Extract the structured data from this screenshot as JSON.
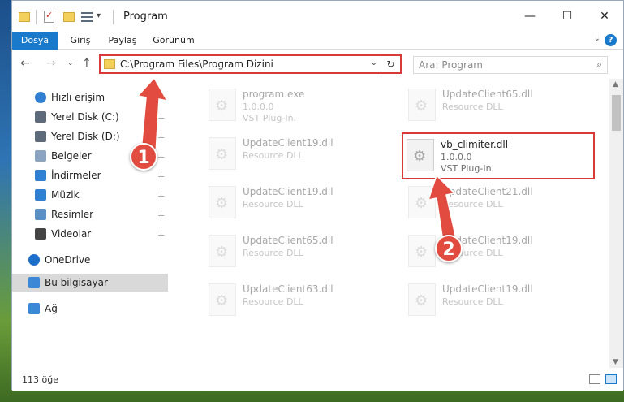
{
  "window": {
    "title": "Program",
    "minimize_glyph": "—",
    "maximize_glyph": "☐",
    "close_glyph": "✕"
  },
  "quick_access_toolbar": {
    "dropdown_glyph": "▾"
  },
  "ribbon": {
    "tabs": [
      "Dosya",
      "Giriş",
      "Paylaş",
      "Görünüm"
    ],
    "expand_glyph": "⌄",
    "help_glyph": "?"
  },
  "navigation": {
    "back_glyph": "←",
    "forward_glyph": "→",
    "recent_glyph": "⌄",
    "up_glyph": "↑"
  },
  "address_bar": {
    "path": "C:\\Program Files\\Program Dizini",
    "dropdown_glyph": "⌄",
    "refresh_glyph": "↻"
  },
  "search": {
    "placeholder": "Ara: Program",
    "icon": "search-icon"
  },
  "sidebar": {
    "items": [
      {
        "label": "Hızlı erişim",
        "icon": "star-icon",
        "pinned": false
      },
      {
        "label": "Yerel Disk (C:)",
        "icon": "drive-icon",
        "pinned": true
      },
      {
        "label": "Yerel Disk (D:)",
        "icon": "drive-icon",
        "pinned": true
      },
      {
        "label": "Belgeler",
        "icon": "documents-icon",
        "pinned": true
      },
      {
        "label": "İndirmeler",
        "icon": "download-icon",
        "pinned": true
      },
      {
        "label": "Müzik",
        "icon": "music-icon",
        "pinned": true
      },
      {
        "label": "Resimler",
        "icon": "pictures-icon",
        "pinned": true
      },
      {
        "label": "Videolar",
        "icon": "videos-icon",
        "pinned": true
      },
      {
        "label": "OneDrive",
        "icon": "cloud-icon",
        "pinned": false
      },
      {
        "label": "Bu bilgisayar",
        "icon": "computer-icon",
        "pinned": false,
        "selected": true
      },
      {
        "label": "Ağ",
        "icon": "network-icon",
        "pinned": false
      }
    ],
    "pin_glyph": "📌"
  },
  "files": [
    {
      "name": "program.exe",
      "line1": "1.0.0.0",
      "line2": "VST Plug-In.",
      "faded": true
    },
    {
      "name": "UpdateClient65.dll",
      "line1": "Resource DLL",
      "line2": "",
      "faded": true
    },
    {
      "name": "UpdateClient19.dll",
      "line1": "Resource DLL",
      "line2": "",
      "faded": true
    },
    {
      "name": "vb_climiter.dll",
      "line1": "1.0.0.0",
      "line2": "VST Plug-In.",
      "faded": false,
      "highlighted": true
    },
    {
      "name": "UpdateClient19.dll",
      "line1": "Resource DLL",
      "line2": "",
      "faded": true
    },
    {
      "name": "UpdateClient21.dll",
      "line1": "Resource DLL",
      "line2": "",
      "faded": true
    },
    {
      "name": "UpdateClient65.dll",
      "line1": "Resource DLL",
      "line2": "",
      "faded": true
    },
    {
      "name": "UpdateClient19.dll",
      "line1": "Resource DLL",
      "line2": "",
      "faded": true
    },
    {
      "name": "UpdateClient63.dll",
      "line1": "Resource DLL",
      "line2": "",
      "faded": true
    },
    {
      "name": "UpdateClient19.dll",
      "line1": "Resource DLL",
      "line2": "",
      "faded": true
    }
  ],
  "status": {
    "item_count": "113 öğe"
  },
  "annotations": {
    "badge_1": "1",
    "badge_2": "2",
    "color": "#e24b3f"
  },
  "scrollbar": {
    "up_glyph": "▲",
    "down_glyph": "▼"
  }
}
